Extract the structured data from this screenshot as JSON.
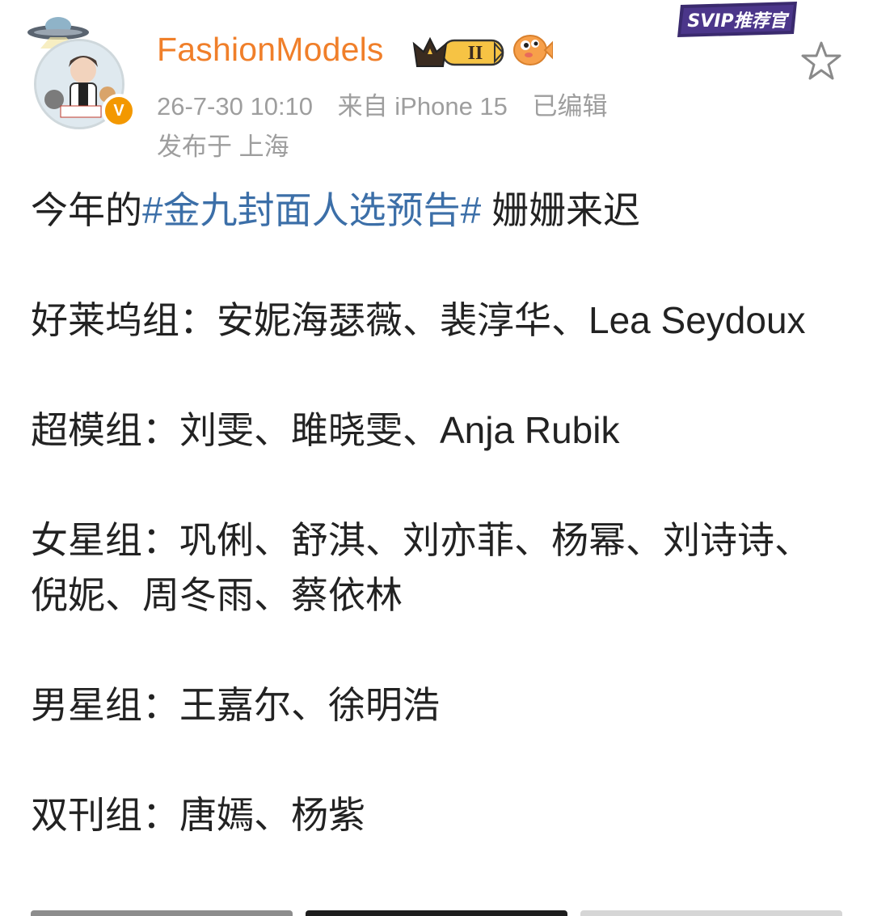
{
  "post": {
    "author": {
      "name": "FashionModels",
      "verified_badge_label": "V",
      "membership_badge_level": "II"
    },
    "svip_badge": "SVIP推荐官",
    "meta": {
      "timestamp": "26-7-30 10:10",
      "source": "来自 iPhone 15",
      "edited": "已编辑",
      "location": "发布于 上海"
    },
    "content": {
      "line1_prefix": "今年的",
      "hashtag": "#金九封面人选预告#",
      "line1_suffix": " 姗姗来迟",
      "hollywood": "好莱坞组：安妮海瑟薇、裴淳华、Lea Seydoux",
      "supermodel": "超模组：刘雯、雎晓雯、Anja Rubik",
      "actress": "女星组：巩俐、舒淇、刘亦菲、杨幂、刘诗诗、倪妮、周冬雨、蔡依林",
      "actor": "男星组：王嘉尔、徐明浩",
      "double_issue": "双刊组：唐嫣、杨紫"
    }
  },
  "colors": {
    "username": "#f07f2a",
    "hashtag": "#3c6fa8",
    "meta": "#9e9e9e",
    "verified": "#f39800"
  }
}
